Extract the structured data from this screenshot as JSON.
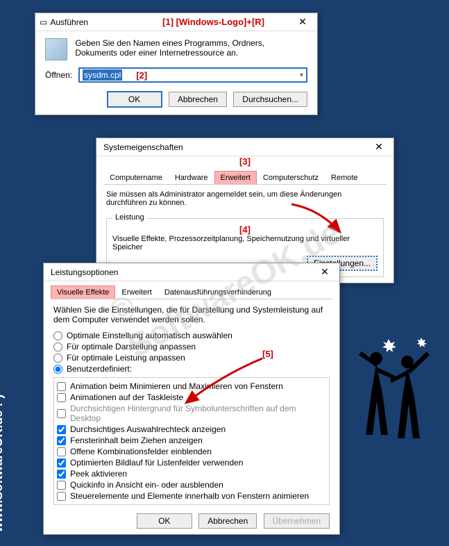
{
  "page": {
    "watermark_side": "www.SoftwareOK.de :-)",
    "watermark_center": "© SoftwareOK.de"
  },
  "run": {
    "title": "Ausführen",
    "annotation": "[1] [Windows-Logo]+[R]",
    "description": "Geben Sie den Namen eines Programms, Ordners, Dokuments oder einer Internetressource an.",
    "open_label": "Öffnen:",
    "value": "sysdm.cpl",
    "ann2": "[2]",
    "ok": "OK",
    "cancel": "Abbrechen",
    "browse": "Durchsuchen..."
  },
  "sysdm": {
    "title": "Systemeigenschaften",
    "ann3": "[3]",
    "tabs": {
      "t0": "Computername",
      "t1": "Hardware",
      "t2": "Erweitert",
      "t3": "Computerschutz",
      "t4": "Remote"
    },
    "admin_note": "Sie müssen als Administrator angemeldet sein, um diese Änderungen durchführen zu können.",
    "perf_legend": "Leistung",
    "ann4": "[4]",
    "perf_desc": "Visuelle Effekte, Prozessorzeitplanung, Speichernutzung und virtueller Speicher",
    "settings_btn": "Einstellungen..."
  },
  "perf": {
    "title": "Leistungsoptionen",
    "tabs": {
      "t0": "Visuelle Effekte",
      "t1": "Erweitert",
      "t2": "Datenausführungsverhinderung"
    },
    "intro": "Wählen Sie die Einstellungen, die für Darstellung und Systemleistung auf dem Computer verwendet werden sollen.",
    "radios": {
      "r0": "Optimale Einstellung automatisch auswählen",
      "r1": "Für optimale Darstellung anpassen",
      "r2": "Für optimale Leistung anpassen",
      "r3": "Benutzerdefiniert:"
    },
    "ann5": "[5]",
    "checks": {
      "c0": "Animation beim Minimieren und Maximieren von Fenstern",
      "c1": "Animationen auf der Taskleiste",
      "c2": "Durchsichtigen Hintergrund für Symbolunterschriften auf dem Desktop",
      "c3": "Durchsichtiges Auswahlrechteck anzeigen",
      "c4": "Fensterinhalt beim Ziehen anzeigen",
      "c5": "Offene Kombinationsfelder einblenden",
      "c6": "Optimierten Bildlauf für Listenfelder verwenden",
      "c7": "Peek aktivieren",
      "c8": "Quickinfo in Ansicht ein- oder ausblenden",
      "c9": "Steuerelemente und Elemente innerhalb von Fenstern animieren"
    },
    "ok": "OK",
    "cancel": "Abbrechen",
    "apply": "Übernehmen"
  }
}
